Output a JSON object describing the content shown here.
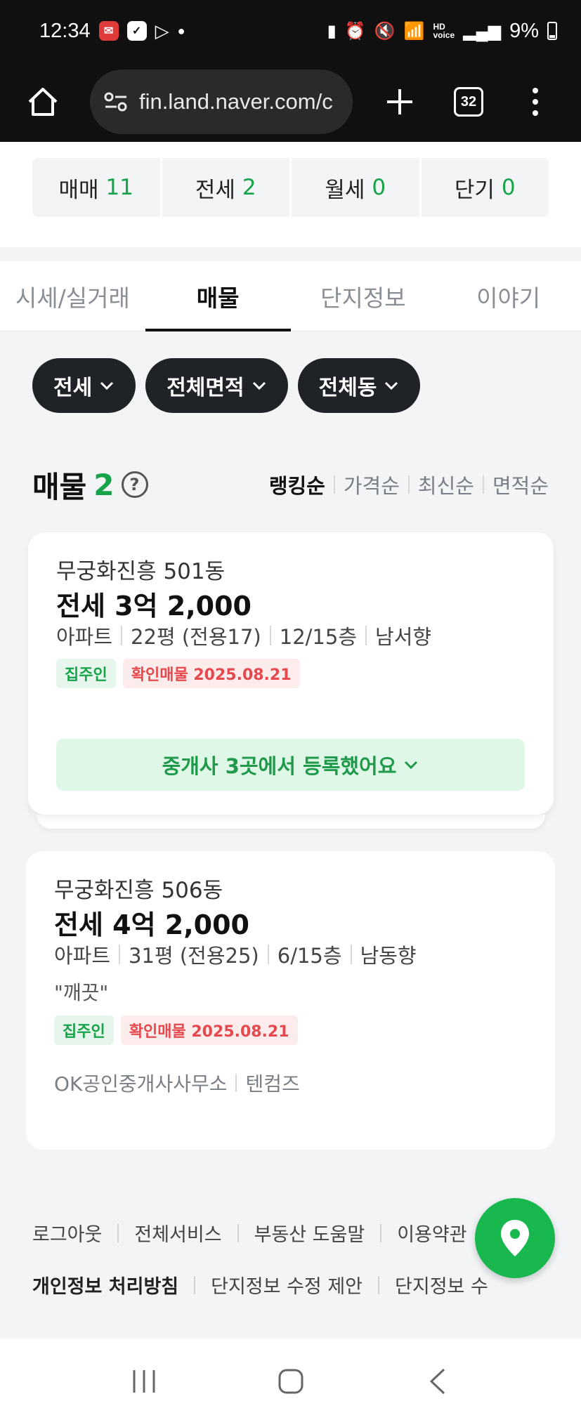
{
  "status_bar": {
    "time": "12:34",
    "battery": "9%"
  },
  "browser": {
    "url": "fin.land.naver.com/c",
    "tab_count": "32"
  },
  "counts": [
    {
      "label": "매매",
      "value": "11"
    },
    {
      "label": "전세",
      "value": "2"
    },
    {
      "label": "월세",
      "value": "0"
    },
    {
      "label": "단기",
      "value": "0"
    }
  ],
  "tabs": [
    {
      "label": "시세/실거래"
    },
    {
      "label": "매물"
    },
    {
      "label": "단지정보"
    },
    {
      "label": "이야기"
    }
  ],
  "filters": [
    {
      "label": "전세"
    },
    {
      "label": "전체면적"
    },
    {
      "label": "전체동"
    }
  ],
  "listing_header": {
    "title": "매물",
    "count": "2",
    "help": "?"
  },
  "sort_options": [
    {
      "label": "랭킹순"
    },
    {
      "label": "가격순"
    },
    {
      "label": "최신순"
    },
    {
      "label": "면적순"
    }
  ],
  "listings": [
    {
      "title": "무궁화진흥 501동",
      "price": "전세 3억 2,000",
      "meta": [
        "아파트",
        "22평 (전용17)",
        "12/15층",
        "남서향"
      ],
      "tag_owner": "집주인",
      "tag_verified": "확인매물 2025.08.21",
      "agents_button": "중개사 3곳에서 등록했어요"
    },
    {
      "title": "무궁화진흥 506동",
      "price": "전세 4억 2,000",
      "meta": [
        "아파트",
        "31평 (전용25)",
        "6/15층",
        "남동향"
      ],
      "note": "\"깨끗\"",
      "tag_owner": "집주인",
      "tag_verified": "확인매물 2025.08.21",
      "agents": [
        "OK공인중개사사무소",
        "텐컴즈"
      ]
    }
  ],
  "footer": {
    "row1": [
      "로그아웃",
      "전체서비스",
      "부동산 도움말",
      "이용약관"
    ],
    "row2": [
      "개인정보 처리방침",
      "단지정보 수정 제안",
      "단지정보 수"
    ]
  },
  "colors": {
    "accent_green": "#17a34a",
    "fab_green": "#18b84f",
    "verified_red": "#e5484d",
    "chip_dark": "#1f2328"
  }
}
